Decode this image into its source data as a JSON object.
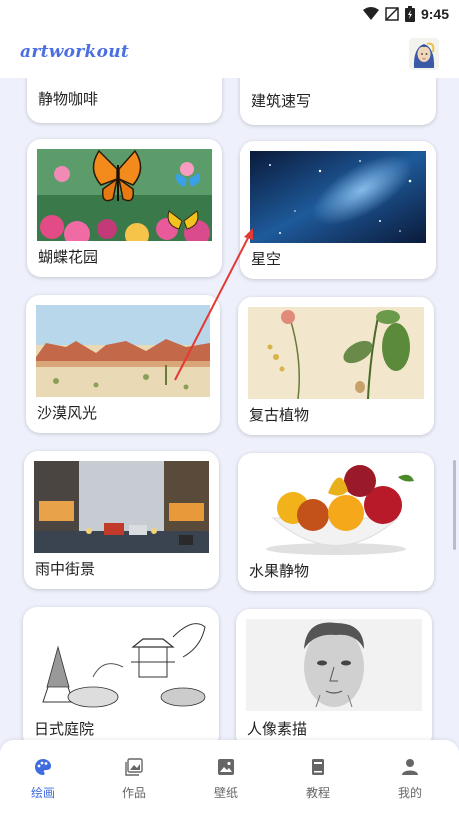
{
  "status": {
    "time": "9:45"
  },
  "app": {
    "logo": "artworkout"
  },
  "cards": [
    {
      "label": "静物咖啡"
    },
    {
      "label": "建筑速写"
    },
    {
      "label": "蝴蝶花园"
    },
    {
      "label": "星空"
    },
    {
      "label": "沙漠风光"
    },
    {
      "label": "复古植物"
    },
    {
      "label": "雨中街景"
    },
    {
      "label": "水果静物"
    },
    {
      "label": "日式庭院"
    },
    {
      "label": "人像素描"
    }
  ],
  "nav": [
    {
      "label": "绘画",
      "icon": "palette-icon",
      "active": true
    },
    {
      "label": "作品",
      "icon": "gallery-icon"
    },
    {
      "label": "壁纸",
      "icon": "wallpaper-icon"
    },
    {
      "label": "教程",
      "icon": "book-icon"
    },
    {
      "label": "我的",
      "icon": "person-icon"
    }
  ],
  "colors": {
    "accent": "#3f6be0",
    "background": "#eef0fb",
    "annotation": "#e53935"
  }
}
